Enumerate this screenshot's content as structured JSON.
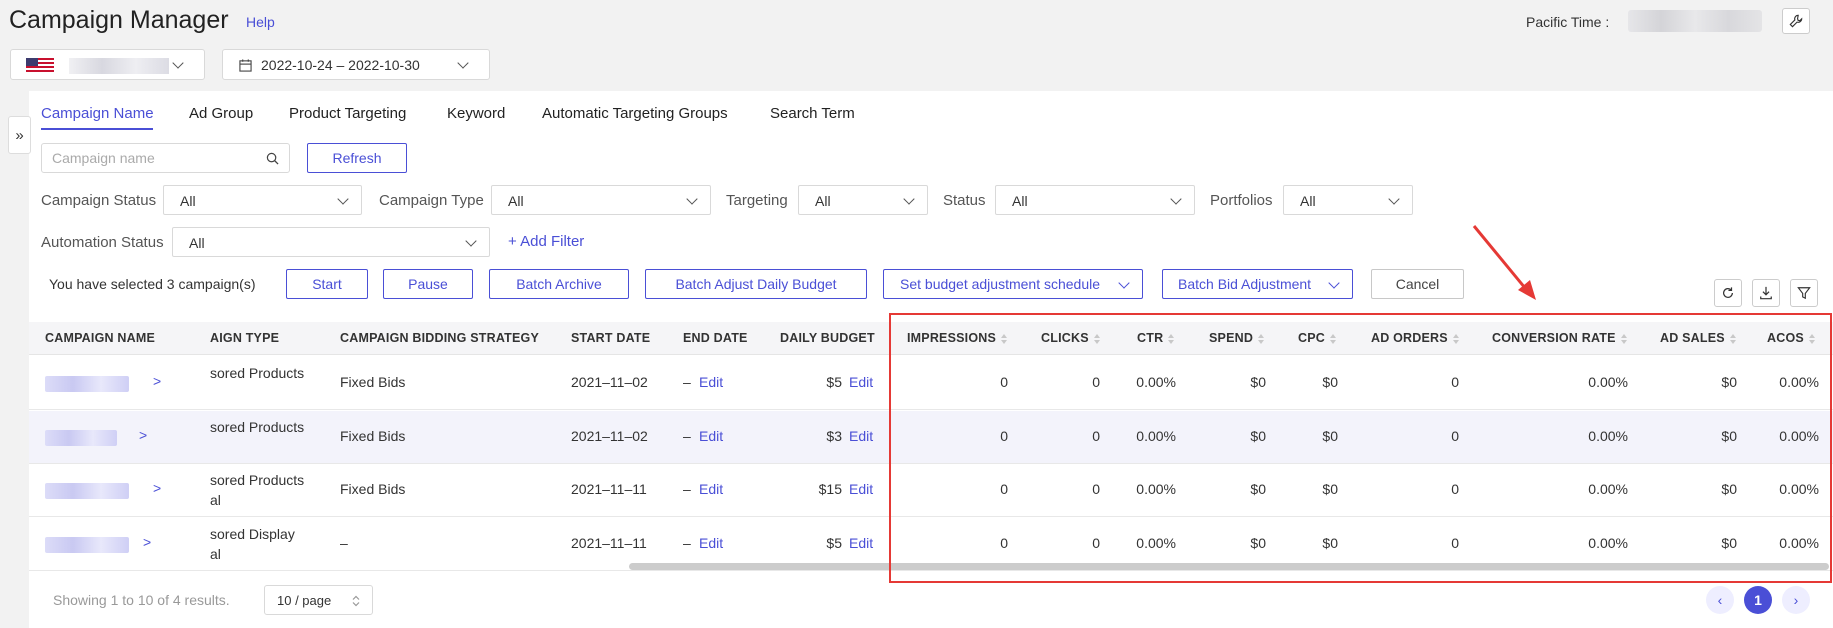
{
  "header": {
    "title": "Campaign Manager",
    "help": "Help",
    "timezone_label": "Pacific Time :",
    "date_range": "2022-10-24 – 2022-10-30"
  },
  "tabs": [
    "Campaign Name",
    "Ad Group",
    "Product Targeting",
    "Keyword",
    "Automatic Targeting Groups",
    "Search Term"
  ],
  "search": {
    "placeholder": "Campaign name",
    "refresh": "Refresh"
  },
  "filters": {
    "campaign_status": {
      "label": "Campaign Status",
      "value": "All"
    },
    "campaign_type": {
      "label": "Campaign Type",
      "value": "All"
    },
    "targeting": {
      "label": "Targeting",
      "value": "All"
    },
    "status": {
      "label": "Status",
      "value": "All"
    },
    "portfolios": {
      "label": "Portfolios",
      "value": "All"
    },
    "automation_status": {
      "label": "Automation Status",
      "value": "All"
    },
    "add_filter": "Add Filter"
  },
  "batch": {
    "selected_text": "You have selected 3 campaign(s)",
    "start": "Start",
    "pause": "Pause",
    "archive": "Batch Archive",
    "adjust_budget": "Batch Adjust Daily Budget",
    "schedule": "Set budget adjustment schedule",
    "bid_adjust": "Batch Bid Adjustment",
    "cancel": "Cancel"
  },
  "table": {
    "headers": {
      "name": "CAMPAIGN NAME",
      "type": "AIGN TYPE",
      "strategy": "CAMPAIGN BIDDING STRATEGY",
      "start": "START DATE",
      "end": "END DATE",
      "budget": "DAILY BUDGET",
      "impressions": "IMPRESSIONS",
      "clicks": "CLICKS",
      "ctr": "CTR",
      "spend": "SPEND",
      "cpc": "CPC",
      "orders": "AD ORDERS",
      "conversion": "CONVERSION RATE",
      "sales": "AD SALES",
      "acos": "ACOS"
    },
    "rows": [
      {
        "type1": "sored Products",
        "type2": "",
        "strategy": "Fixed Bids",
        "start": "2021–11–02",
        "end": "–",
        "edit": "Edit",
        "budget": "$5",
        "impressions": "0",
        "clicks": "0",
        "ctr": "0.00%",
        "spend": "$0",
        "cpc": "$0",
        "orders": "0",
        "conversion": "0.00%",
        "sales": "$0",
        "acos": "0.00%"
      },
      {
        "type1": "sored Products",
        "type2": "",
        "strategy": "Fixed Bids",
        "start": "2021–11–02",
        "end": "–",
        "edit": "Edit",
        "budget": "$3",
        "impressions": "0",
        "clicks": "0",
        "ctr": "0.00%",
        "spend": "$0",
        "cpc": "$0",
        "orders": "0",
        "conversion": "0.00%",
        "sales": "$0",
        "acos": "0.00%"
      },
      {
        "type1": "sored Products",
        "type2": "al",
        "strategy": "Fixed Bids",
        "start": "2021–11–11",
        "end": "–",
        "edit": "Edit",
        "budget": "$15",
        "impressions": "0",
        "clicks": "0",
        "ctr": "0.00%",
        "spend": "$0",
        "cpc": "$0",
        "orders": "0",
        "conversion": "0.00%",
        "sales": "$0",
        "acos": "0.00%"
      },
      {
        "type1": "sored Display",
        "type2": "al",
        "strategy": "–",
        "start": "2021–11–11",
        "end": "–",
        "edit": "Edit",
        "budget": "$5",
        "impressions": "0",
        "clicks": "0",
        "ctr": "0.00%",
        "spend": "$0",
        "cpc": "$0",
        "orders": "0",
        "conversion": "0.00%",
        "sales": "$0",
        "acos": "0.00%"
      }
    ]
  },
  "footer": {
    "showing": "Showing 1 to 10 of 4 results.",
    "page_size": "10 / page",
    "current_page": "1"
  },
  "colors": {
    "accent": "#4a4fd6",
    "highlight": "#e53935"
  }
}
